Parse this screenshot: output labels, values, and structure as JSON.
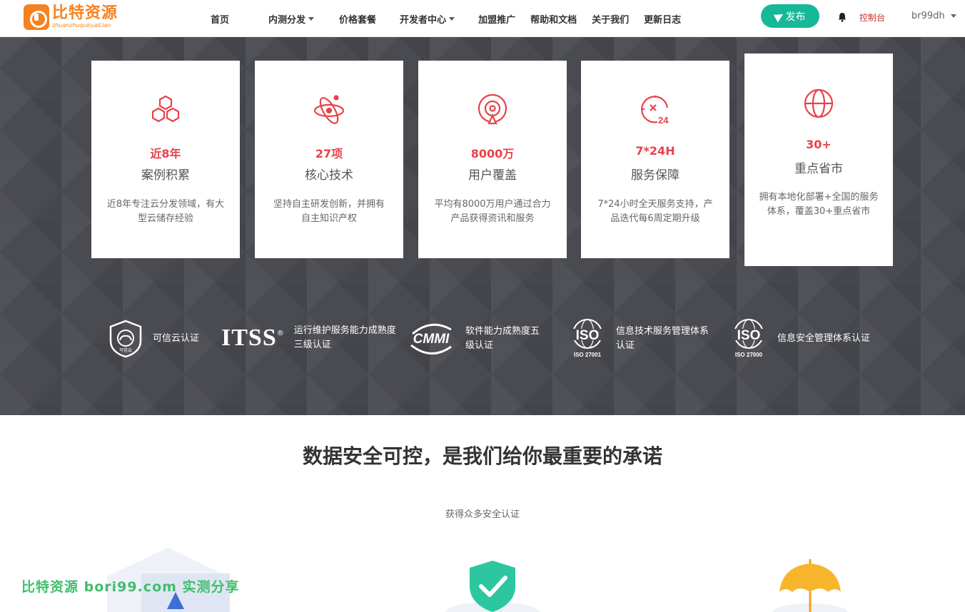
{
  "header": {
    "logo_cn": "比特资源",
    "logo_en": "zhuanzhuqukuaiLian",
    "nav": [
      {
        "label": "首页",
        "dropdown": false
      },
      {
        "label": "内测分发",
        "dropdown": true
      },
      {
        "label": "价格套餐",
        "dropdown": false
      },
      {
        "label": "开发者中心",
        "dropdown": true
      },
      {
        "label": "加盟推广",
        "dropdown": false
      },
      {
        "label": "帮助和文档",
        "dropdown": false
      },
      {
        "label": "关于我们",
        "dropdown": false
      },
      {
        "label": "更新日志",
        "dropdown": false
      }
    ],
    "publish_label": "发布",
    "console_label": "控制台",
    "username": "br99dh"
  },
  "stats": [
    {
      "icon": "cubes-icon",
      "number": "近8年",
      "title": "案例积累",
      "desc": "近8年专注云分发领域，有大型云储存经验"
    },
    {
      "icon": "atom-icon",
      "number": "27项",
      "title": "核心技术",
      "desc": "坚持自主研发创新，并拥有自主知识产权"
    },
    {
      "icon": "users-icon",
      "number": "8000万",
      "title": "用户覆盖",
      "desc": "平均有8000万用户通过合力产品获得资讯和服务"
    },
    {
      "icon": "clock-24-icon",
      "number": "7*24H",
      "title": "服务保障",
      "desc": "7*24小时全天服务支持，产品迭代每6周定期升级"
    },
    {
      "icon": "globe-icon",
      "number": "30+",
      "title": "重点省市",
      "desc": "拥有本地化部署+全国的服务体系，覆盖30+重点省市"
    }
  ],
  "certs": [
    {
      "logo": "可信云",
      "text": "可信云认证"
    },
    {
      "logo": "ITSS",
      "text": "运行维护服务能力成熟度三级认证"
    },
    {
      "logo": "CMMI",
      "text": "软件能力成熟度五级认证"
    },
    {
      "logo": "ISO",
      "sub": "ISO 27001",
      "text": "信息技术服务管理体系认证"
    },
    {
      "logo": "ISO",
      "sub": "ISO 27000",
      "text": "信息安全管理体系认证"
    }
  ],
  "section": {
    "heading": "数据安全可控，是我们给你最重要的承诺",
    "subheading": "获得众多安全认证"
  },
  "watermark": "比特资源 bori99.com 实测分享",
  "colors": {
    "accent": "#e8424a",
    "brand": "#f58220",
    "publish": "#17b897",
    "band": "#4a4b51"
  }
}
